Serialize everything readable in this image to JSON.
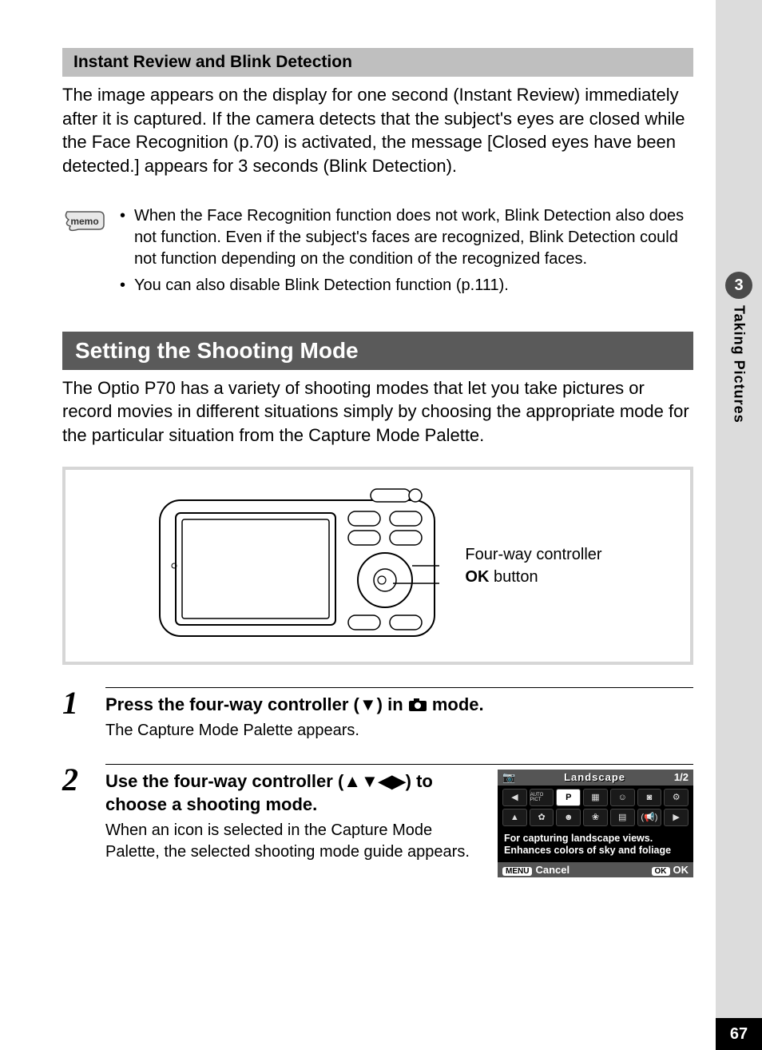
{
  "sideTab": {
    "chapterNum": "3",
    "chapterTitle": "Taking Pictures"
  },
  "pageNumber": "67",
  "section1": {
    "heading": "Instant Review and Blink Detection",
    "body": "The image appears on the display for one second (Instant Review) immediately after it is captured. If the camera detects that the subject's eyes are closed while the Face Recognition (p.70) is activated, the message [Closed eyes have been detected.] appears for 3 seconds (Blink Detection)."
  },
  "memo": {
    "label": "memo",
    "items": [
      "When the Face Recognition function does not work, Blink Detection also does not function. Even if the subject's faces are recognized, Blink Detection could not function depending on the condition of the recognized faces.",
      "You can also disable Blink Detection function (p.111)."
    ]
  },
  "section2": {
    "heading": "Setting the Shooting Mode",
    "body": "The Optio P70 has a variety of shooting modes that let you take pictures or record movies in different situations simply by choosing the appropriate mode for the particular situation from the Capture Mode Palette."
  },
  "diagramLabels": {
    "fourWay": "Four-way controller",
    "okBold": "OK",
    "okRest": " button"
  },
  "steps": [
    {
      "num": "1",
      "titlePre": "Press the four-way controller (",
      "titleTri": "▼",
      "titleMid": ") in ",
      "titlePost": " mode.",
      "desc": "The Capture Mode Palette appears."
    },
    {
      "num": "2",
      "titlePre": "Use the four-way controller (",
      "titleTri": "▲▼◀▶",
      "titlePost": ") to choose a shooting mode.",
      "desc": "When an icon is selected in the Capture Mode Palette, the selected shooting mode guide appears."
    }
  ],
  "lcd": {
    "title": "Landscape",
    "page": "1/2",
    "desc": "For capturing landscape views. Enhances colors of sky and foliage",
    "menuBtn": "MENU",
    "cancel": "Cancel",
    "okBtn": "OK",
    "ok": "OK",
    "row1": [
      "AUTO PICT",
      "P",
      "▦",
      "☺",
      "◙",
      "⚙"
    ],
    "row2": [
      "▲",
      "✿",
      "☻",
      "❀",
      "▤",
      "(📢)"
    ]
  }
}
